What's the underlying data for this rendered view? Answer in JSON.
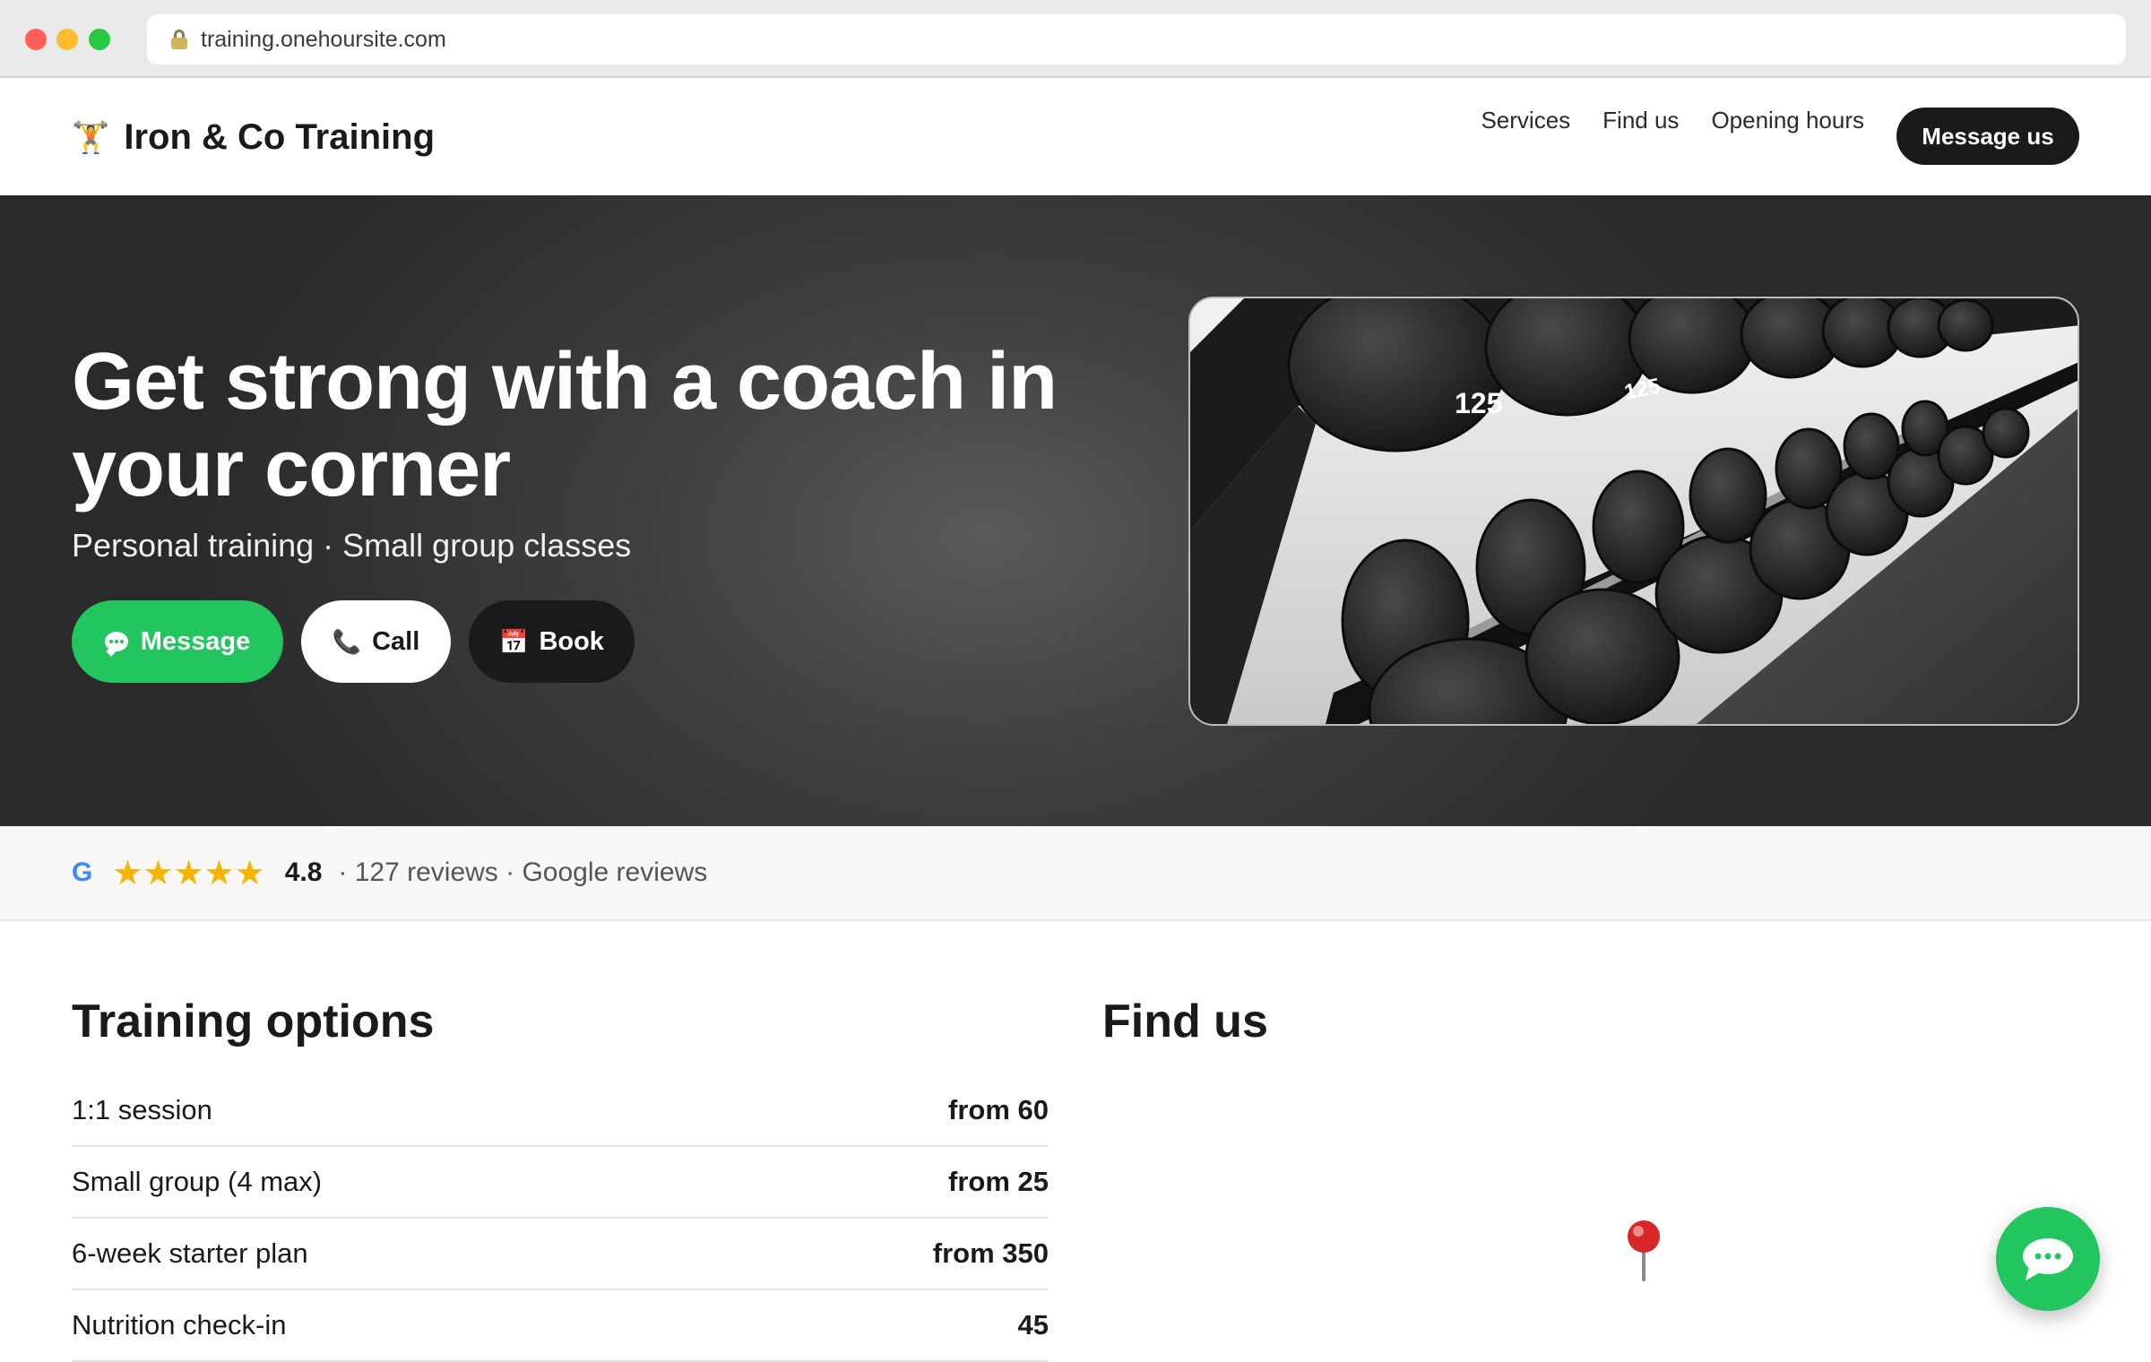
{
  "browser": {
    "url": "training.onehoursite.com",
    "lock_icon": "lock-icon"
  },
  "header": {
    "brand_icon": "weightlifter-icon",
    "brand_name": "Iron & Co Training",
    "nav": [
      {
        "label": "Services"
      },
      {
        "label": "Find us"
      },
      {
        "label": "Opening hours"
      }
    ],
    "cta_label": "Message us"
  },
  "hero": {
    "title": "Get strong with a coach in your corner",
    "subtitle": "Personal training · Small group classes",
    "buttons": [
      {
        "label": "Message",
        "icon": "chat-bubble-icon",
        "color": "#22c55e"
      },
      {
        "label": "Call",
        "icon": "phone-icon"
      },
      {
        "label": "Book",
        "icon": "calendar-icon"
      }
    ],
    "photo": {
      "plate_label_1": "125",
      "plate_label_2": "125"
    }
  },
  "reviews": {
    "source_icon": "google-g-icon",
    "stars": "★★★★★",
    "rating": "4.8",
    "meta": "· 127 reviews · Google reviews",
    "star_color": "#f5b400"
  },
  "training": {
    "title": "Training options",
    "options": [
      {
        "name": "1:1 session",
        "price": "from 60"
      },
      {
        "name": "Small group (4 max)",
        "price": "from 25"
      },
      {
        "name": "6-week starter plan",
        "price": "from 350"
      },
      {
        "name": "Nutrition check-in",
        "price": "45"
      }
    ]
  },
  "findus": {
    "title": "Find us",
    "pin_icon": "map-pin-icon"
  },
  "chat_fab": {
    "icon": "chat-bubble-icon",
    "color": "#22c55e"
  }
}
